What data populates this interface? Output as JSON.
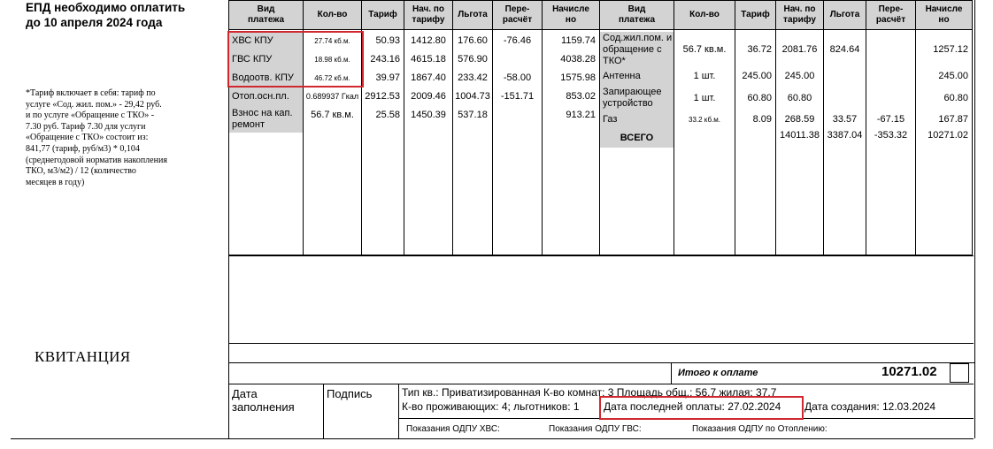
{
  "left": {
    "title_line1": "ЕПД необходимо оплатить",
    "title_line2": "до 10 апреля 2024 года",
    "note_lines": [
      "*Тариф включает в себя: тариф по",
      "услуге «Сод. жил. пом.» - 29,42 руб.",
      "и по услуге «Обращение с ТКО» -",
      "7.30 руб. Тариф  7.30 для услуги",
      "«Обращение с ТКО» состоит из:",
      "841,77 (тариф, руб/м3) * 0,104",
      "(среднегодовой норматив накопления",
      "ТКО, м3/м2) / 12 (количество",
      "месяцев в году)"
    ],
    "receipt_label": "КВИТАНЦИЯ"
  },
  "table": {
    "headers": {
      "type": [
        "Вид",
        "платежа"
      ],
      "qty": "Кол-во",
      "tariff": "Тариф",
      "accrued_tariff": [
        "Нач. по",
        "тарифу"
      ],
      "discount": "Льгота",
      "recalc": [
        "Пере-",
        "расчёт"
      ],
      "accrued": [
        "Начисле",
        "но"
      ]
    },
    "left_rows": [
      {
        "name": "ХВС КПУ",
        "qty": "27.74 кб.м.",
        "tariff": "50.93",
        "accrued_tariff": "1412.80",
        "discount": "176.60",
        "recalc": "-76.46",
        "accrued": "1159.74"
      },
      {
        "name": "ГВС КПУ",
        "qty": "18.98 кб.м.",
        "tariff": "243.16",
        "accrued_tariff": "4615.18",
        "discount": "576.90",
        "recalc": "",
        "accrued": "4038.28"
      },
      {
        "name": "Водоотв. КПУ",
        "qty": "46.72 кб.м.",
        "tariff": "39.97",
        "accrued_tariff": "1867.40",
        "discount": "233.42",
        "recalc": "-58.00",
        "accrued": "1575.98"
      },
      {
        "name": "Отоп.осн.пл.",
        "qty": "0.689937 Гкал",
        "tariff": "2912.53",
        "accrued_tariff": "2009.46",
        "discount": "1004.73",
        "recalc": "-151.71",
        "accrued": "853.02"
      },
      {
        "name": "Взнос на кап. ремонт",
        "qty": "56.7 кв.м.",
        "tariff": "25.58",
        "accrued_tariff": "1450.39",
        "discount": "537.18",
        "recalc": "",
        "accrued": "913.21"
      }
    ],
    "right_rows": [
      {
        "name": "Сод.жил.пом. и обращение с ТКО*",
        "qty": "56.7 кв.м.",
        "tariff": "36.72",
        "accrued_tariff": "2081.76",
        "discount": "824.64",
        "recalc": "",
        "accrued": "1257.12"
      },
      {
        "name": "Антенна",
        "qty": "1 шт.",
        "tariff": "245.00",
        "accrued_tariff": "245.00",
        "discount": "",
        "recalc": "",
        "accrued": "245.00"
      },
      {
        "name": "Запирающее устройство",
        "qty": "1 шт.",
        "tariff": "60.80",
        "accrued_tariff": "60.80",
        "discount": "",
        "recalc": "",
        "accrued": "60.80"
      },
      {
        "name": "Газ",
        "qty": "33.2 кб.м.",
        "tariff": "8.09",
        "accrued_tariff": "268.59",
        "discount": "33.57",
        "recalc": "-67.15",
        "accrued": "167.87"
      }
    ],
    "total": {
      "label": "ВСЕГО",
      "accrued_tariff": "14011.38",
      "discount": "3387.04",
      "recalc": "-353.32",
      "accrued": "10271.02"
    }
  },
  "summary": {
    "total_label": "Итого к оплате",
    "total_value": "10271.02"
  },
  "footer": {
    "date_fill_label": "Дата заполнения",
    "signature_label": "Подпись",
    "info_line1": "Тип кв.: Приватизированная К-во комнат: 3 Площадь общ.: 56.7 жилая: 37.7",
    "info_line2_a": "К-во проживающих: 4; льготников: 1",
    "last_payment": "Дата последней оплаты: 27.02.2024",
    "created": "Дата создания: 12.03.2024",
    "odpu_hvs": "Показания ОДПУ ХВС:",
    "odpu_gvs": "Показания ОДПУ ГВС:",
    "odpu_heat": "Показания ОДПУ по Отоплению:"
  },
  "highlight_color": "#d0282e",
  "header_gray": "#d3d3d3"
}
